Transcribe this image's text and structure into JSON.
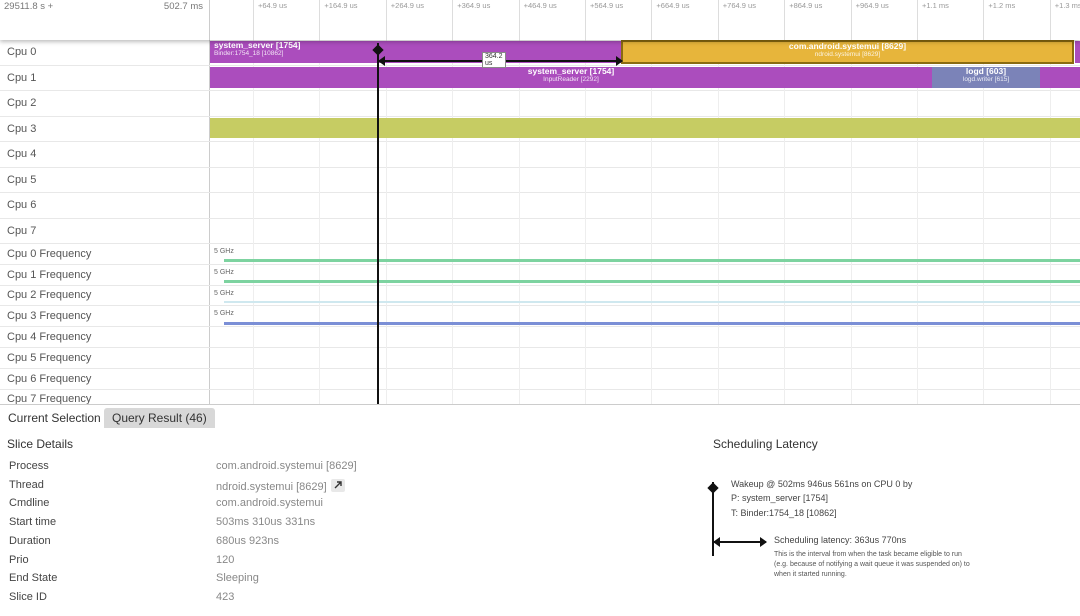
{
  "ruler": {
    "origin": "29511.8 s +",
    "span": "502.7 ms",
    "ticks": [
      "+64.9 us",
      "+164.9 us",
      "+264.9 us",
      "+364.9 us",
      "+464.9 us",
      "+564.9 us",
      "+664.9 us",
      "+764.9 us",
      "+864.9 us",
      "+964.9 us",
      "+1.1 ms",
      "+1.2 ms",
      "+1.3 ms"
    ]
  },
  "tracks": [
    {
      "label": "Cpu 0"
    },
    {
      "label": "Cpu 1"
    },
    {
      "label": "Cpu 2"
    },
    {
      "label": "Cpu 3"
    },
    {
      "label": "Cpu 4"
    },
    {
      "label": "Cpu 5"
    },
    {
      "label": "Cpu 6"
    },
    {
      "label": "Cpu 7"
    },
    {
      "label": "Cpu 0 Frequency",
      "freq": "5 GHz"
    },
    {
      "label": "Cpu 1 Frequency",
      "freq": "5 GHz"
    },
    {
      "label": "Cpu 2 Frequency",
      "freq": "5 GHz"
    },
    {
      "label": "Cpu 3 Frequency",
      "freq": "5 GHz"
    },
    {
      "label": "Cpu 4 Frequency"
    },
    {
      "label": "Cpu 5 Frequency"
    },
    {
      "label": "Cpu 6 Frequency"
    },
    {
      "label": "Cpu 7 Frequency"
    }
  ],
  "slices": {
    "cpu0_a": {
      "title": "system_server [1754]",
      "sub": "Binder:1754_18 [10862]"
    },
    "cpu0_b": {
      "title": "com.android.systemui [8629]",
      "sub": "ndroid.systemui [8629]"
    },
    "cpu1_a": {
      "title": "system_server [1754]",
      "sub": "InputReader [2292]"
    },
    "cpu1_b": {
      "title": "logd [603]",
      "sub": "logd.writer [615]"
    }
  },
  "latency_badge": "364.2 us",
  "colors": {
    "system_server": "#ab4dbd",
    "systemui": "#e7b53b",
    "logd": "#7b83b8",
    "cpu3": "#c6cc63",
    "freq_green": "#7dd3a0",
    "freq_blue": "#7b8fd6"
  },
  "tabs": {
    "current": "Current Selection",
    "query": "Query Result (46)"
  },
  "slice_details": {
    "title": "Slice Details",
    "rows": [
      {
        "key": "Process",
        "value": "com.android.systemui [8629]"
      },
      {
        "key": "Thread",
        "value": "ndroid.systemui [8629]"
      },
      {
        "key": "Cmdline",
        "value": "com.android.systemui"
      },
      {
        "key": "Start time",
        "value": "503ms 310us 331ns"
      },
      {
        "key": "Duration",
        "value": "680us 923ns"
      },
      {
        "key": "Prio",
        "value": "120"
      },
      {
        "key": "End State",
        "value": "Sleeping"
      },
      {
        "key": "Slice ID",
        "value": "423"
      }
    ]
  },
  "scheduling": {
    "title": "Scheduling Latency",
    "wakeup": "Wakeup @ 502ms 946us 561ns on CPU 0 by",
    "process": "P: system_server [1754]",
    "thread": "T: Binder:1754_18 [10862]",
    "latency": "Scheduling latency: 363us 770ns",
    "explain1": "This is the interval from when the task became eligible to run",
    "explain2": "(e.g. because of notifying a wait queue it was suspended on) to",
    "explain3": "when it started running."
  }
}
